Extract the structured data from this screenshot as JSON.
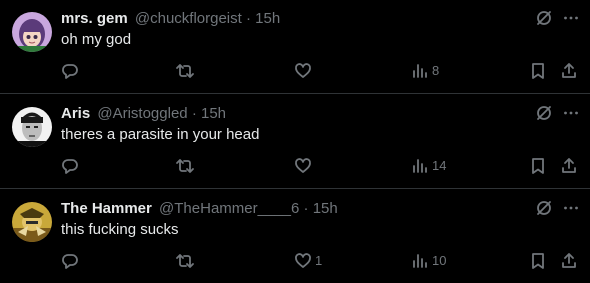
{
  "tweets": [
    {
      "name": "mrs. gem",
      "handle": "@chuckflorgeist",
      "separator": "·",
      "time": "15h",
      "text": "oh my god",
      "reply_count": "",
      "retweet_count": "",
      "like_count": "",
      "view_count": "8",
      "avatar_colors": {
        "bg": "#c9a7de",
        "hair": "#5b3b7a",
        "skin": "#f4d6c4"
      }
    },
    {
      "name": "Aris",
      "handle": "@Aristoggled",
      "separator": "·",
      "time": "15h",
      "text": "theres a parasite in your head",
      "reply_count": "",
      "retweet_count": "",
      "like_count": "",
      "view_count": "14",
      "avatar_colors": {
        "bg": "#f2f2f2",
        "hair": "#1a1a1a",
        "skin": "#bdbdbd"
      }
    },
    {
      "name": "The Hammer",
      "handle": "@TheHammer____6",
      "separator": "·",
      "time": "15h",
      "text": "this fucking sucks",
      "reply_count": "",
      "retweet_count": "",
      "like_count": "1",
      "view_count": "10",
      "avatar_colors": {
        "bg": "#c9a83a",
        "hair": "#7a5a1a",
        "skin": "#e2c36a"
      }
    }
  ],
  "icons": {
    "reply": "reply-icon",
    "retweet": "retweet-icon",
    "like": "like-icon",
    "views": "views-icon",
    "bookmark": "bookmark-icon",
    "share": "share-icon",
    "grok": "grok-icon",
    "more": "more-icon"
  },
  "colors": {
    "background": "#000000",
    "text": "#e7e9ea",
    "secondary": "#71767b",
    "divider": "#2f3336"
  }
}
